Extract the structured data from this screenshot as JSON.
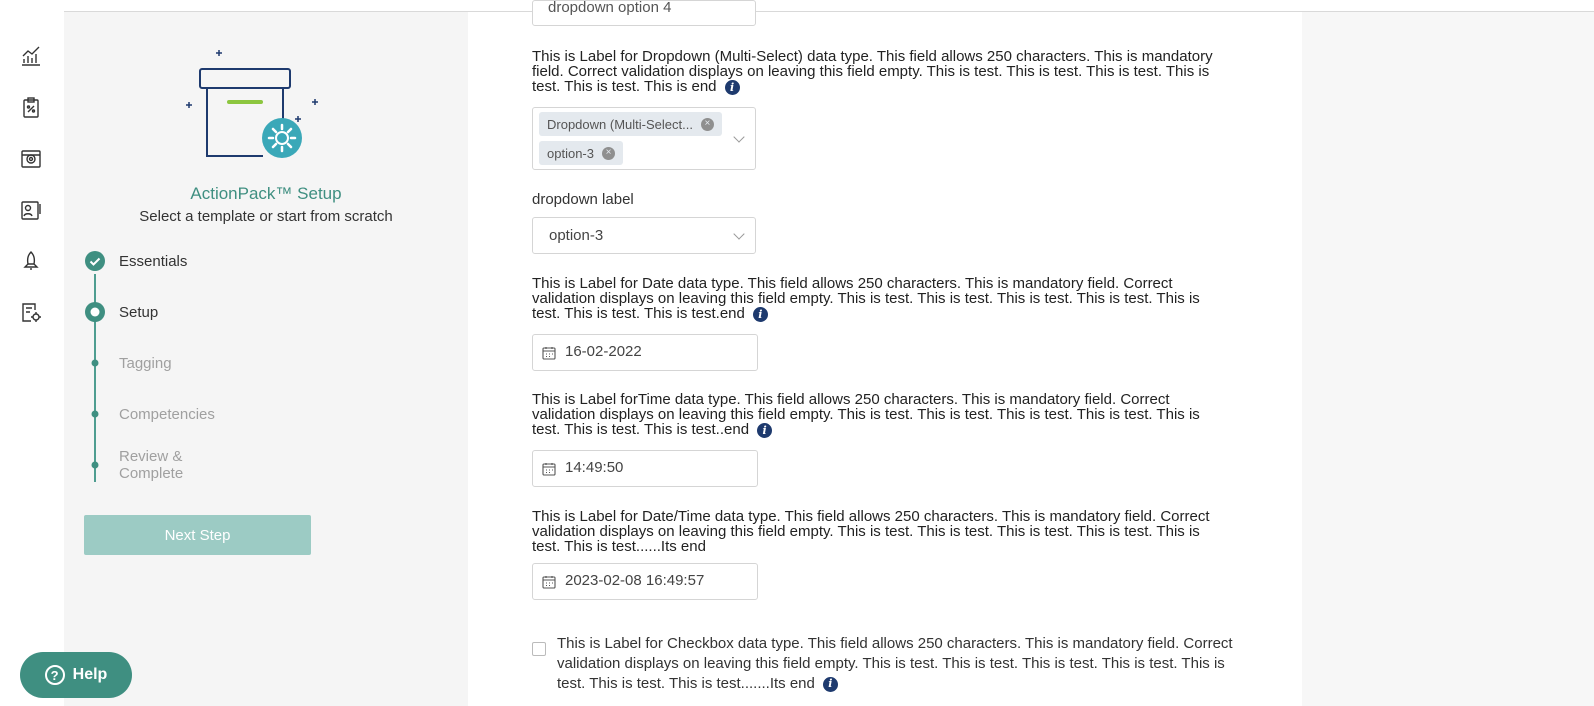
{
  "sidebar": {
    "icons": [
      "chart-icon",
      "clipboard-icon",
      "camera-icon",
      "id-card-icon",
      "rocket-icon",
      "settings-doc-icon"
    ]
  },
  "setup": {
    "title": "ActionPack™ Setup",
    "subtitle": "Select a template or start from scratch",
    "steps": [
      {
        "label": "Essentials",
        "state": "done"
      },
      {
        "label": "Setup",
        "state": "active"
      },
      {
        "label": "Tagging",
        "state": "todo"
      },
      {
        "label": "Competencies",
        "state": "todo"
      },
      {
        "label": "Review & Complete",
        "state": "todo"
      }
    ],
    "next_label": "Next Step",
    "help_label": "Help"
  },
  "form": {
    "top_partial_value": "dropdown option 4",
    "multiselect": {
      "label": "This is Label for Dropdown (Multi-Select) data type. This field allows 250 characters. This is mandatory field. Correct validation displays on leaving this field empty. This is test. This is test. This is test. This is test. This is test. This is end",
      "chips": [
        "Dropdown (Multi-Select...",
        "option-3"
      ]
    },
    "dropdown": {
      "label": "dropdown label",
      "value": "option-3"
    },
    "date": {
      "label": "This is Label for Date data type. This field allows 250 characters. This is mandatory field. Correct validation displays on leaving this field empty. This is test. This is test. This is test. This is test. This is test. This is test. This is test.end",
      "value": "16-02-2022"
    },
    "time": {
      "label": "This is Label forTime data type. This field allows 250 characters. This is mandatory field. Correct validation displays on leaving this field empty. This is test. This is test. This is test. This is test. This is test. This is test. This is test..end",
      "value": "14:49:50"
    },
    "datetime": {
      "label": "This is Label for Date/Time data type. This field allows 250 characters. This is mandatory field. Correct validation displays on leaving this field empty. This is test. This is test. This is test. This is test. This is test. This is test......Its end",
      "value": "2023-02-08 16:49:57"
    },
    "checkbox": {
      "label": "This is Label for Checkbox data type. This field allows 250 characters. This is mandatory field. Correct validation displays on leaving this field empty. This is test. This is test. This is test. This is test. This is test. This is test. This is test.......Its end"
    }
  },
  "colors": {
    "accent": "#3f8f81",
    "accent_light": "#9ccbc4",
    "info": "#1e3a6e"
  }
}
